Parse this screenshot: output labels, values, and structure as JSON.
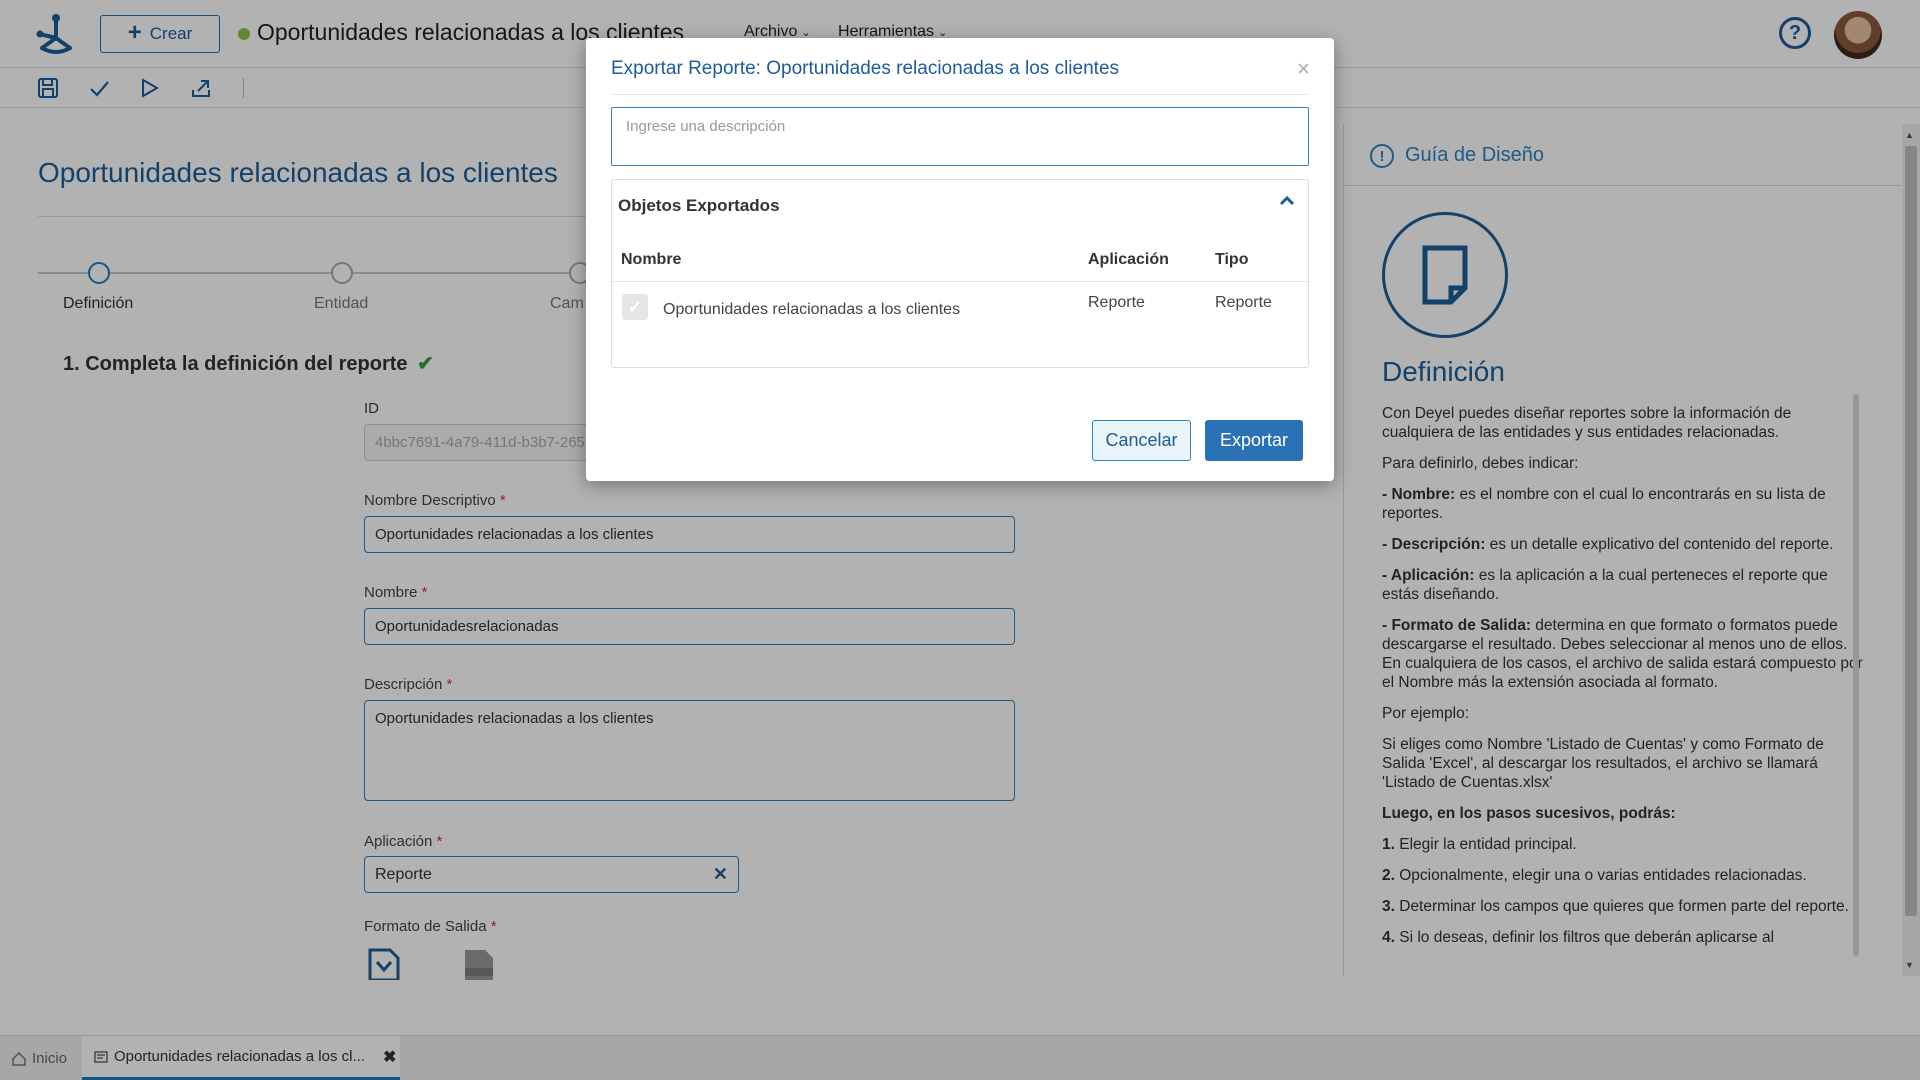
{
  "header": {
    "create_label": "Crear",
    "doc_title": "Oportunidades relacionadas a los clientes",
    "menus": [
      "Archivo",
      "Herramientas"
    ],
    "help_label": "?"
  },
  "main": {
    "page_title": "Oportunidades relacionadas a los clientes",
    "steps": [
      "Definición",
      "Entidad",
      "Cam"
    ],
    "section_title": "1. Completa la definición del reporte",
    "section_check": "✔",
    "fields": {
      "id_label": "ID",
      "id_value": "4bbc7691-4a79-411d-b3b7-265",
      "nombre_descriptivo_label": "Nombre Descriptivo",
      "nombre_descriptivo_value": "Oportunidades relacionadas a los clientes",
      "nombre_label": "Nombre",
      "nombre_value": "Oportunidadesrelacionadas",
      "descripcion_label": "Descripción",
      "descripcion_value": "Oportunidades relacionadas a los clientes",
      "aplicacion_label": "Aplicación",
      "aplicacion_value": "Reporte",
      "formato_label": "Formato de Salida",
      "required_mark": "*"
    }
  },
  "guide": {
    "title": "Guía de Diseño",
    "heading": "Definición",
    "p1": "Con Deyel puedes diseñar reportes sobre la información de cualquiera de las entidades y sus entidades relacionadas.",
    "p2": "Para definirlo, debes indicar:",
    "items": [
      {
        "term": "- Nombre:",
        "text": " es el nombre con el cual lo encontrarás en su lista de reportes."
      },
      {
        "term": "- Descripción:",
        "text": " es un detalle explicativo del contenido del reporte."
      },
      {
        "term": "- Aplicación:",
        "text": " es la aplicación a la cual perteneces el reporte que estás diseñando."
      },
      {
        "term": "- Formato de Salida:",
        "text": " determina en que formato o formatos puede descargarse el resultado. Debes seleccionar al menos uno de ellos. En cualquiera de los casos, el archivo de salida estará compuesto por el Nombre más la extensión asociada al formato."
      }
    ],
    "p3": "Por ejemplo:",
    "p4": "Si eliges como Nombre 'Listado de Cuentas' y como Formato de Salida 'Excel', al descargar los resultados, el archivo se llamará 'Listado de Cuentas.xlsx'",
    "p5": "Luego, en los pasos sucesivos, podrás:",
    "steps": [
      {
        "num": "1.",
        "text": " Elegir la entidad principal."
      },
      {
        "num": "2.",
        "text": " Opcionalmente, elegir una o varias entidades relacionadas."
      },
      {
        "num": "3.",
        "text": " Determinar los campos que quieres que formen parte del reporte."
      },
      {
        "num": "4.",
        "text": " Si lo deseas, definir los filtros que deberán aplicarse al"
      }
    ]
  },
  "bottom_tabs": {
    "home": "Inicio",
    "active": "Oportunidades relacionadas a los cl..."
  },
  "dialog": {
    "title": "Exportar Reporte: Oportunidades relacionadas a los clientes",
    "close": "×",
    "desc_placeholder": "Ingrese una descripción",
    "panel_title": "Objetos Exportados",
    "columns": [
      "Nombre",
      "Aplicación",
      "Tipo"
    ],
    "rows": [
      {
        "nombre": "Oportunidades relacionadas a los clientes",
        "aplicacion": "Reporte",
        "tipo": "Reporte"
      }
    ],
    "cancel_label": "Cancelar",
    "export_label": "Exportar"
  }
}
